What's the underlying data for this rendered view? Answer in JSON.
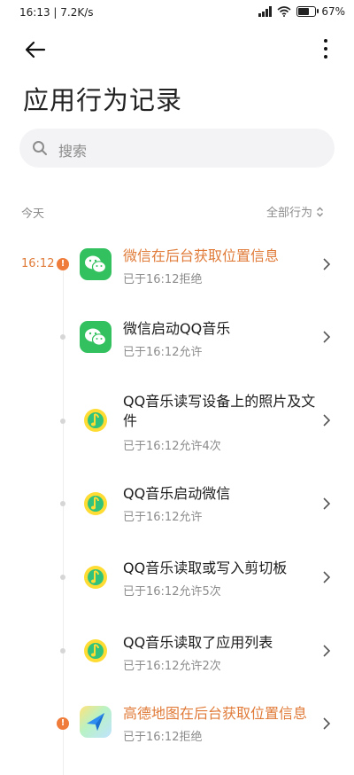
{
  "status_bar": {
    "time_speed": "16:13 | 7.2K/s",
    "battery": "67%",
    "battery_level": 0.67
  },
  "header": {
    "title": "应用行为记录"
  },
  "search": {
    "placeholder": "搜索"
  },
  "list_header": {
    "day": "今天",
    "filter": "全部行为"
  },
  "records": [
    {
      "time": "16:12",
      "warning": true,
      "app_icon": "wechat-icon",
      "title": "微信在后台获取位置信息",
      "subtitle": "已于16:12拒绝"
    },
    {
      "time": "",
      "warning": false,
      "app_icon": "wechat-icon",
      "title": "微信启动QQ音乐",
      "subtitle": "已于16:12允许"
    },
    {
      "time": "",
      "warning": false,
      "app_icon": "qq-music-icon",
      "title": "QQ音乐读写设备上的照片及文件",
      "subtitle": "已于16:12允许4次"
    },
    {
      "time": "",
      "warning": false,
      "app_icon": "qq-music-icon",
      "title": "QQ音乐启动微信",
      "subtitle": "已于16:12允许"
    },
    {
      "time": "",
      "warning": false,
      "app_icon": "qq-music-icon",
      "title": "QQ音乐读取或写入剪切板",
      "subtitle": "已于16:12允许5次"
    },
    {
      "time": "",
      "warning": false,
      "app_icon": "qq-music-icon",
      "title": "QQ音乐读取了应用列表",
      "subtitle": "已于16:12允许2次"
    },
    {
      "time": "",
      "warning": true,
      "app_icon": "amap-icon",
      "title": "高德地图在后台获取位置信息",
      "subtitle": "已于16:12拒绝"
    }
  ]
}
